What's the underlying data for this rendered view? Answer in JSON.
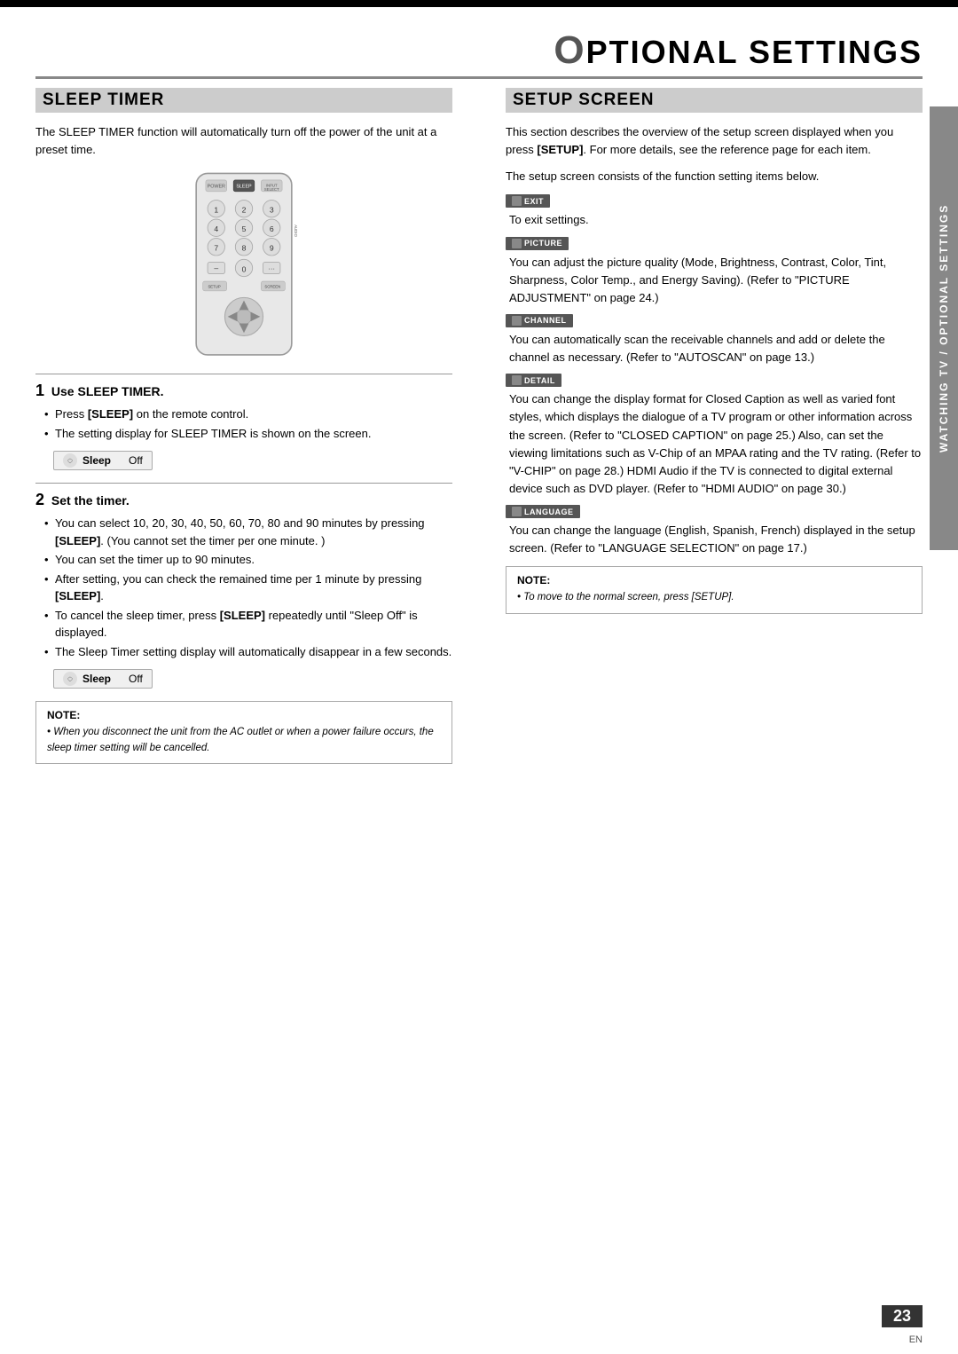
{
  "page": {
    "title": "OPTIONAL SETTINGS",
    "title_first_letter": "O",
    "title_rest": "PTIONAL SETTINGS",
    "page_number": "23",
    "page_lang": "EN",
    "sidebar_label": "WATCHING TV / OPTIONAL SETTINGS"
  },
  "sleep_timer": {
    "section_title": "SLEEP TIMER",
    "intro": "The SLEEP TIMER function will automatically turn off the power of the unit at a preset time.",
    "step1_number": "1",
    "step1_title": "Use SLEEP TIMER.",
    "step1_bullets": [
      "Press [SLEEP] on the remote control.",
      "The setting display for SLEEP TIMER is shown on the screen."
    ],
    "sleep_badge_text": "Sleep",
    "sleep_badge_value": "Off",
    "step2_number": "2",
    "step2_title": "Set the timer.",
    "step2_bullets": [
      "You can select 10, 20, 30, 40, 50, 60, 70, 80 and 90 minutes by pressing [SLEEP]. (You cannot set the timer per one minute. )",
      "You can set the timer up to 90 minutes.",
      "After setting, you can check the remained time per 1 minute by pressing [SLEEP].",
      "To cancel the sleep timer, press [SLEEP] repeatedly until \"Sleep Off\" is displayed.",
      "The Sleep Timer setting display will automatically disappear in a few seconds."
    ],
    "note_title": "NOTE:",
    "note_text": "• When you disconnect the unit from the AC outlet or when a power failure occurs, the sleep timer setting will be cancelled."
  },
  "setup_screen": {
    "section_title": "SETUP SCREEN",
    "intro_lines": [
      "This section describes the overview of the setup screen displayed when you press [SETUP].",
      "For more details, see the reference page for each item.",
      "",
      "The setup screen consists of the function setting items below."
    ],
    "menu_items": [
      {
        "badge": "EXIT",
        "description": "To exit settings."
      },
      {
        "badge": "PICTURE",
        "description": "You can adjust the picture quality (Mode, Brightness, Contrast, Color, Tint, Sharpness, Color Temp., and Energy Saving). (Refer to \"PICTURE ADJUSTMENT\" on page 24.)"
      },
      {
        "badge": "CHANNEL",
        "description": "You can automatically scan the receivable channels and add or delete the channel as necessary. (Refer to \"AUTOSCAN\" on page 13.)"
      },
      {
        "badge": "DETAIL",
        "description": "You can change the display format for Closed Caption as well as varied font styles, which displays the dialogue of a TV program or other information across the screen. (Refer to \"CLOSED CAPTION\" on page 25.) Also, can set the viewing limitations such as V-Chip of an MPAA rating and the TV rating. (Refer to \"V-CHIP\" on page 28.) HDMI Audio if the TV is connected to digital external device such as DVD player. (Refer to \"HDMI AUDIO\" on page 30.)"
      },
      {
        "badge": "LANGUAGE",
        "description": "You can change the language (English, Spanish, French) displayed in the setup screen. (Refer to \"LANGUAGE SELECTION\" on page 17.)"
      }
    ],
    "note_title": "NOTE:",
    "note_text": "• To move to the normal screen, press [SETUP]."
  }
}
